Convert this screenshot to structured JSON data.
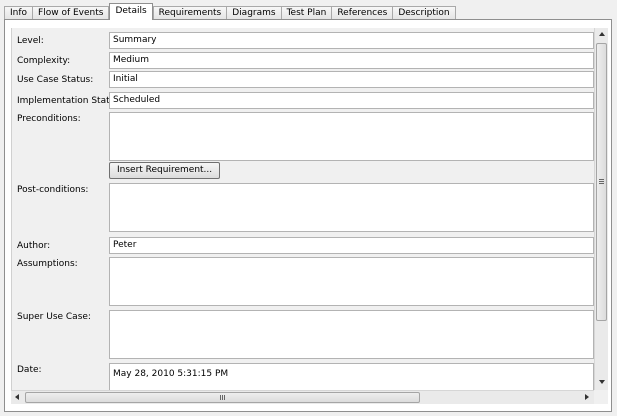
{
  "tabs": [
    {
      "label": "Info"
    },
    {
      "label": "Flow of Events"
    },
    {
      "label": "Details",
      "active": true
    },
    {
      "label": "Requirements"
    },
    {
      "label": "Diagrams"
    },
    {
      "label": "Test Plan"
    },
    {
      "label": "References"
    },
    {
      "label": "Description"
    }
  ],
  "form": {
    "level": {
      "label": "Level:",
      "value": "Summary"
    },
    "complexity": {
      "label": "Complexity:",
      "value": "Medium"
    },
    "status": {
      "label": "Use Case Status:",
      "value": "Initial"
    },
    "impl_status": {
      "label": "Implementation Status:",
      "value": "Scheduled"
    },
    "preconditions": {
      "label": "Preconditions:",
      "value": ""
    },
    "insert_requirement": "Insert Requirement...",
    "postconditions": {
      "label": "Post-conditions:",
      "value": ""
    },
    "author": {
      "label": "Author:",
      "value": "Peter"
    },
    "assumptions": {
      "label": "Assumptions:",
      "value": ""
    },
    "super_use_case": {
      "label": "Super Use Case:",
      "value": ""
    },
    "date": {
      "label": "Date:",
      "value": "May 28, 2010 5:31:15 PM"
    }
  },
  "icons": {
    "v_up": "scroll-up-arrow",
    "v_down": "scroll-down-arrow",
    "h_left": "scroll-left-arrow",
    "h_right": "scroll-right-arrow"
  }
}
